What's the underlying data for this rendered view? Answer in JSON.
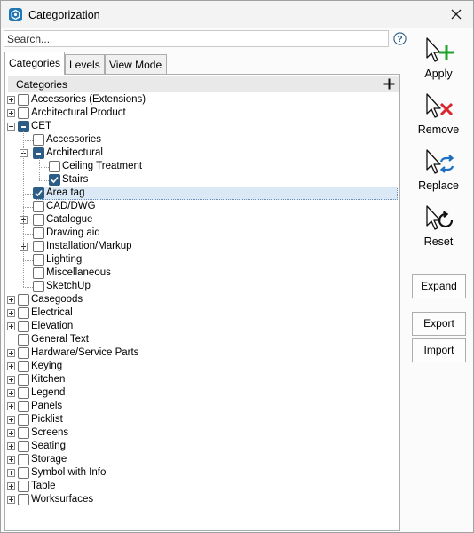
{
  "window": {
    "title": "Categorization",
    "accent": "#1f77b4"
  },
  "search": {
    "placeholder": "Search...",
    "value": ""
  },
  "help": {
    "icon": "help-icon"
  },
  "tabs": [
    {
      "label": "Categories",
      "active": true
    },
    {
      "label": "Levels",
      "active": false
    },
    {
      "label": "View Mode",
      "active": false
    }
  ],
  "tree": {
    "header": "Categories",
    "items": [
      {
        "label": "Accessories (Extensions)",
        "level": 0,
        "expander": "plus",
        "check": "none"
      },
      {
        "label": "Architectural Product",
        "level": 0,
        "expander": "plus",
        "check": "none"
      },
      {
        "label": "CET",
        "level": 0,
        "expander": "minus",
        "check": "partial"
      },
      {
        "label": "Accessories",
        "level": 1,
        "expander": "",
        "check": "none"
      },
      {
        "label": "Architectural",
        "level": 1,
        "expander": "minus",
        "check": "partial"
      },
      {
        "label": "Ceiling Treatment",
        "level": 2,
        "expander": "",
        "check": "none"
      },
      {
        "label": "Stairs",
        "level": 2,
        "expander": "",
        "check": "checked"
      },
      {
        "label": "Area tag",
        "level": 1,
        "expander": "",
        "check": "checked",
        "selected": true
      },
      {
        "label": "CAD/DWG",
        "level": 1,
        "expander": "",
        "check": "none"
      },
      {
        "label": "Catalogue",
        "level": 1,
        "expander": "plus",
        "check": "none"
      },
      {
        "label": "Drawing aid",
        "level": 1,
        "expander": "",
        "check": "none"
      },
      {
        "label": "Installation/Markup",
        "level": 1,
        "expander": "plus",
        "check": "none"
      },
      {
        "label": "Lighting",
        "level": 1,
        "expander": "",
        "check": "none"
      },
      {
        "label": "Miscellaneous",
        "level": 1,
        "expander": "",
        "check": "none"
      },
      {
        "label": "SketchUp",
        "level": 1,
        "expander": "",
        "check": "none"
      },
      {
        "label": "Casegoods",
        "level": 0,
        "expander": "plus",
        "check": "none"
      },
      {
        "label": "Electrical",
        "level": 0,
        "expander": "plus",
        "check": "none"
      },
      {
        "label": "Elevation",
        "level": 0,
        "expander": "plus",
        "check": "none"
      },
      {
        "label": "General Text",
        "level": 0,
        "expander": "",
        "check": "none"
      },
      {
        "label": "Hardware/Service Parts",
        "level": 0,
        "expander": "plus",
        "check": "none"
      },
      {
        "label": "Keying",
        "level": 0,
        "expander": "plus",
        "check": "none"
      },
      {
        "label": "Kitchen",
        "level": 0,
        "expander": "plus",
        "check": "none"
      },
      {
        "label": "Legend",
        "level": 0,
        "expander": "plus",
        "check": "none"
      },
      {
        "label": "Panels",
        "level": 0,
        "expander": "plus",
        "check": "none"
      },
      {
        "label": "Picklist",
        "level": 0,
        "expander": "plus",
        "check": "none"
      },
      {
        "label": "Screens",
        "level": 0,
        "expander": "plus",
        "check": "none"
      },
      {
        "label": "Seating",
        "level": 0,
        "expander": "plus",
        "check": "none"
      },
      {
        "label": "Storage",
        "level": 0,
        "expander": "plus",
        "check": "none"
      },
      {
        "label": "Symbol with Info",
        "level": 0,
        "expander": "plus",
        "check": "none"
      },
      {
        "label": "Table",
        "level": 0,
        "expander": "plus",
        "check": "none"
      },
      {
        "label": "Worksurfaces",
        "level": 0,
        "expander": "plus",
        "check": "none"
      }
    ]
  },
  "actions": {
    "apply": "Apply",
    "remove": "Remove",
    "replace": "Replace",
    "reset": "Reset",
    "expand": "Expand",
    "export": "Export",
    "import": "Import"
  },
  "colors": {
    "check_fill": "#2c5d86",
    "apply_plus": "#1fa12b",
    "remove_x": "#d9262c",
    "replace_arrows": "#1f6fc2",
    "selection": "#dbe9f6"
  }
}
